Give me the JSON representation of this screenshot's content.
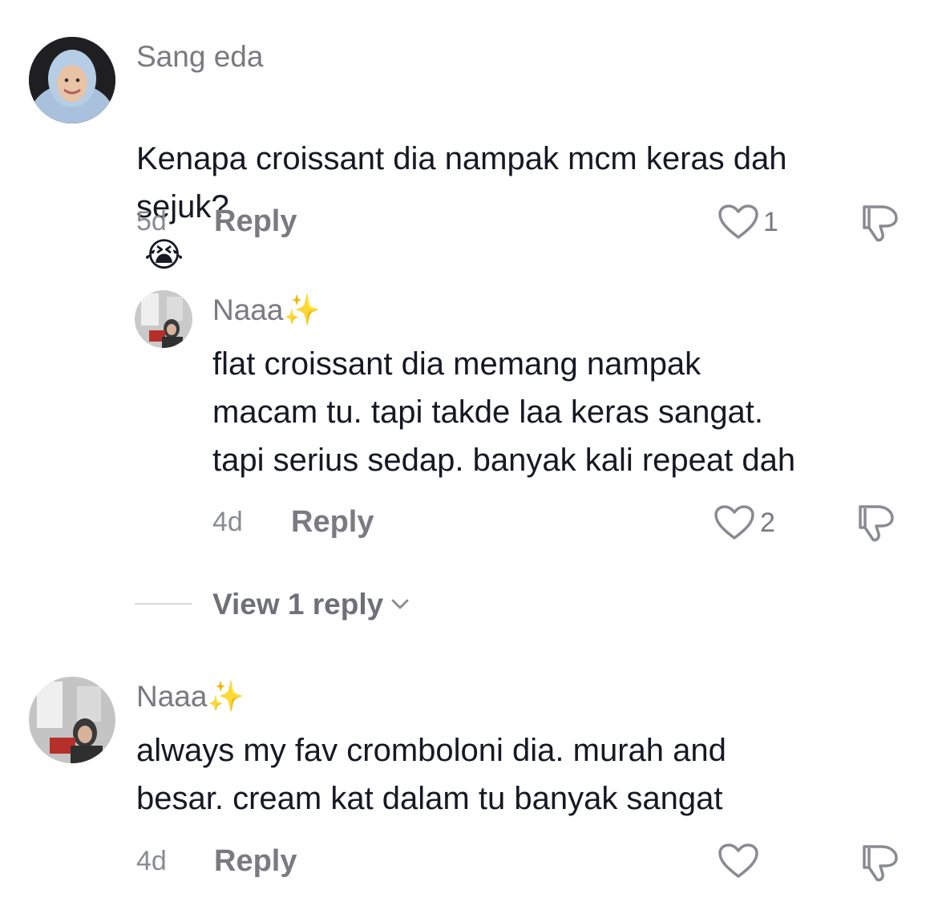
{
  "comments": [
    {
      "username": "Sang eda",
      "text": "Kenapa croissant dia nampak mcm keras dah\nsejuk?",
      "emoji": "😭",
      "time": "5d",
      "reply_label": "Reply",
      "likes": "1"
    },
    {
      "username": "Naaa",
      "username_emoji": "✨",
      "text": "flat croissant dia memang nampak\nmacam tu. tapi takde laa keras sangat.\ntapi serius sedap. banyak kali repeat dah",
      "time": "4d",
      "reply_label": "Reply",
      "likes": "2",
      "view_replies": "View 1 reply"
    },
    {
      "username": "Naaa",
      "username_emoji": "✨",
      "text": "always my fav cromboloni dia. murah and\nbesar. cream kat dalam tu banyak sangat",
      "time": "4d",
      "reply_label": "Reply",
      "likes": ""
    }
  ],
  "icons": {
    "like": "heart-outline-icon",
    "dislike": "thumbs-down-outline-icon",
    "expand": "chevron-down-icon"
  },
  "colors": {
    "text": "#161823",
    "secondary": "#7a7a80",
    "icon": "#8a8b91"
  }
}
